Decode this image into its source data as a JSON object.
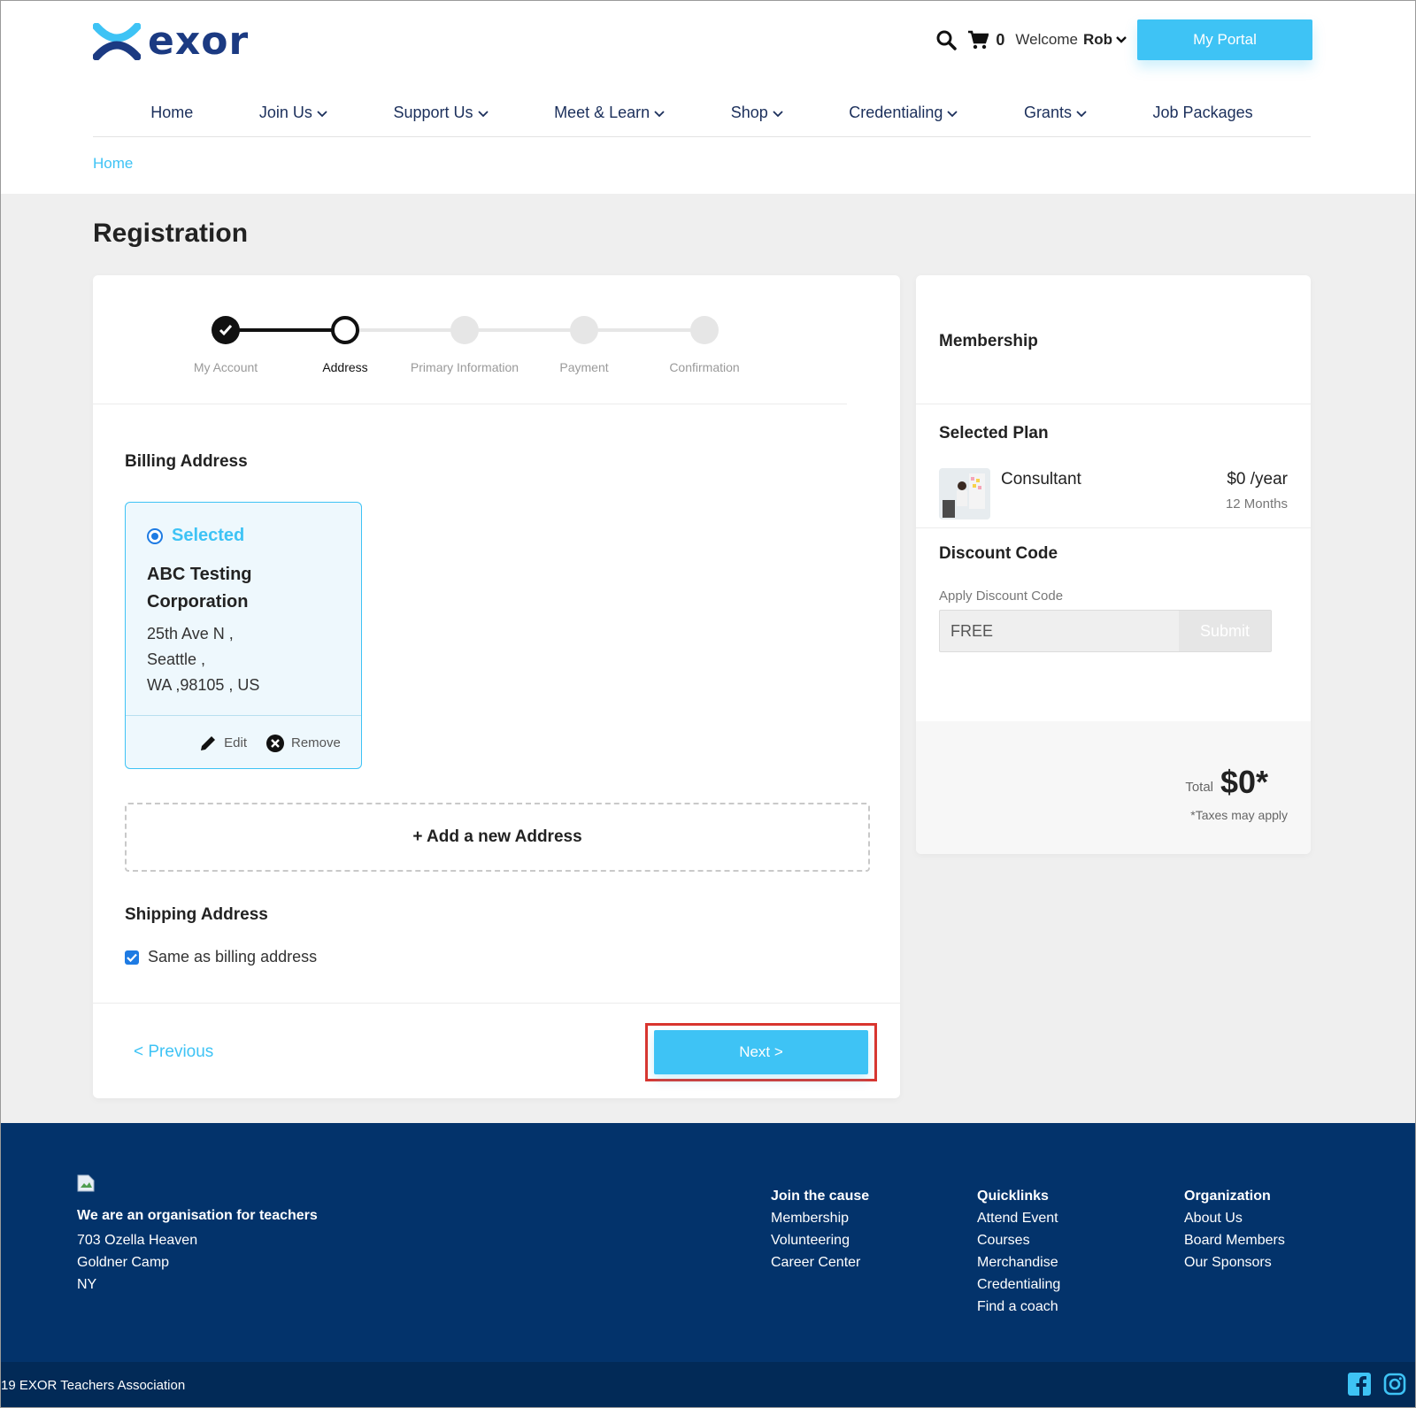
{
  "brand": {
    "logo_text": "exor",
    "accent": "#3ec3f5",
    "navy": "#03336b"
  },
  "topbar": {
    "cart_count": "0",
    "welcome": "Welcome",
    "user_name": "Rob",
    "portal_label": "My Portal"
  },
  "nav": {
    "items": [
      "Home",
      "Join Us",
      "Support Us",
      "Meet & Learn",
      "Shop",
      "Credentialing",
      "Grants",
      "Job Packages"
    ]
  },
  "breadcrumb": {
    "home": "Home"
  },
  "page": {
    "title": "Registration"
  },
  "stepper": {
    "steps": [
      "My Account",
      "Address",
      "Primary Information",
      "Payment",
      "Confirmation"
    ],
    "current_step": 2
  },
  "billing": {
    "title": "Billing Address",
    "selected_label": "Selected",
    "name": "ABC Testing Corporation",
    "line1": "25th Ave N ,",
    "line2": "Seattle ,",
    "line3": "WA ,98105 , US",
    "edit_label": "Edit",
    "remove_label": "Remove",
    "add_label": "+ Add a new Address"
  },
  "shipping": {
    "title": "Shipping Address",
    "same_label": "Same as billing address",
    "same_checked": true
  },
  "actions": {
    "previous_label": "< Previous",
    "next_label": "Next >"
  },
  "summary": {
    "membership_title": "Membership",
    "selected_plan_title": "Selected Plan",
    "plan_name": "Consultant",
    "plan_price": "$0 /year",
    "plan_duration": "12 Months",
    "discount_title": "Discount Code",
    "discount_label": "Apply Discount Code",
    "discount_value": "FREE",
    "submit_label": "Submit",
    "total_label": "Total",
    "total_value": "$0*",
    "taxes_note": "*Taxes may apply"
  },
  "footer": {
    "tagline": "We are an organisation for teachers",
    "address": [
      "703 Ozella Heaven",
      "Goldner Camp",
      "NY"
    ],
    "columns": [
      {
        "title": "Join the cause",
        "links": [
          "Membership",
          "Volunteering",
          "Career Center"
        ]
      },
      {
        "title": "Quicklinks",
        "links": [
          "Attend Event",
          "Courses",
          "Merchandise",
          "Credentialing",
          "Find a coach"
        ]
      },
      {
        "title": "Organization",
        "links": [
          "About Us",
          "Board Members",
          "Our Sponsors"
        ]
      }
    ],
    "copyright": "19 EXOR Teachers Association"
  }
}
